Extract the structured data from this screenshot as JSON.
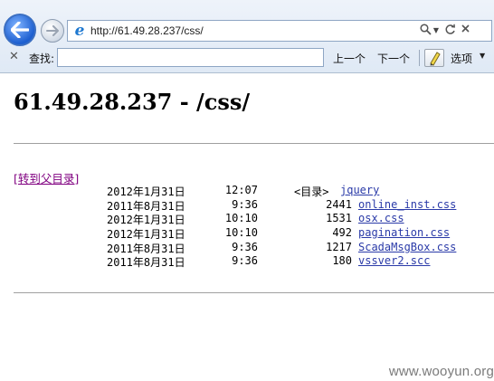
{
  "address_bar": {
    "url": "http://61.49.28.237/css/"
  },
  "find_bar": {
    "label": "查找:",
    "value": "",
    "previous_label": "上一个",
    "next_label": "下一个",
    "options_label": "选项"
  },
  "page": {
    "title": "61.49.28.237 - /css/",
    "parent_link": "[转到父目录]",
    "entries": [
      {
        "date": "2012年1月31日",
        "time": "12:07",
        "size": "<目录>",
        "name": "jquery",
        "is_dir": true
      },
      {
        "date": "2011年8月31日",
        "time": "9:36",
        "size": "2441",
        "name": "online_inst.css",
        "is_dir": false
      },
      {
        "date": "2012年1月31日",
        "time": "10:10",
        "size": "1531",
        "name": "osx.css",
        "is_dir": false
      },
      {
        "date": "2012年1月31日",
        "time": "10:10",
        "size": "492",
        "name": "pagination.css",
        "is_dir": false
      },
      {
        "date": "2011年8月31日",
        "time": "9:36",
        "size": "1217",
        "name": "ScadaMsgBox.css",
        "is_dir": false
      },
      {
        "date": "2011年8月31日",
        "time": "9:36",
        "size": "180",
        "name": "vssver2.scc",
        "is_dir": false
      }
    ]
  },
  "watermark": "www.wooyun.org",
  "colors": {
    "link": "#2a3aa8",
    "visited_link": "#800080",
    "rule": "#a0a0a0"
  },
  "icons": {
    "back": "back-arrow-icon",
    "forward": "forward-arrow-icon",
    "page": "ie-icon",
    "search": "search-icon",
    "refresh": "refresh-icon",
    "stop": "close-icon",
    "highlight": "highlighter-pen-icon"
  }
}
